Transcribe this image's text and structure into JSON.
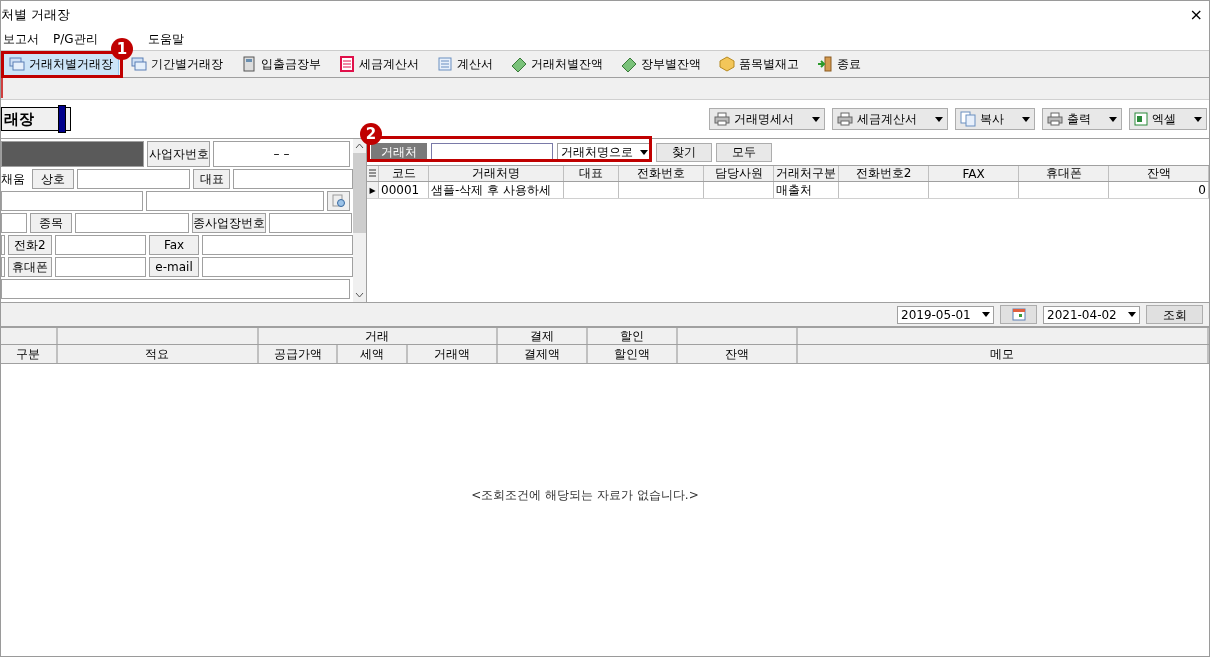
{
  "window": {
    "title": "처별 거래장",
    "close": "×"
  },
  "menu": [
    "보고서",
    "P/G관리",
    "도움말"
  ],
  "toolbar": [
    {
      "label": "거래처별거래장",
      "selected": true
    },
    {
      "label": "기간별거래장",
      "selected": false
    },
    {
      "label": "입출금장부",
      "selected": false
    },
    {
      "label": "세금계산서",
      "selected": false
    },
    {
      "label": "계산서",
      "selected": false
    },
    {
      "label": "거래처별잔액",
      "selected": false
    },
    {
      "label": "장부별잔액",
      "selected": false
    },
    {
      "label": "품목별재고",
      "selected": false
    },
    {
      "label": "종료",
      "selected": false
    }
  ],
  "page_title": "래장",
  "actions": [
    "거래명세서",
    "세금계산서",
    "복사",
    "출력",
    "엑셀"
  ],
  "form": {
    "business_no_label": "사업자번호",
    "business_no_value": "–   –",
    "fill_label": "채움",
    "name_label": "상호",
    "rep_label": "대표",
    "item_label": "종목",
    "branch_label": "종사업장번호",
    "phone2_label": "전화2",
    "fax_label": "Fax",
    "mobile_label": "휴대폰",
    "email_label": "e-mail"
  },
  "search": {
    "label": "거래처",
    "mode": "거래처명으로",
    "find": "찾기",
    "all": "모두"
  },
  "grid": {
    "columns": [
      "코드",
      "거래처명",
      "대표",
      "전화번호",
      "담당사원",
      "거래처구분",
      "전화번호2",
      "FAX",
      "휴대폰",
      "잔액"
    ],
    "rows": [
      {
        "marker": "▶",
        "cells": [
          "00001",
          "샘플-삭제 후 사용하세",
          "",
          "",
          "",
          "매출처",
          "",
          "",
          "",
          "0"
        ]
      }
    ]
  },
  "period": {
    "from": "2019-05-01",
    "to": "2021-04-02",
    "query": "조회"
  },
  "ledger": {
    "groups": [
      "거래",
      "결제",
      "할인"
    ],
    "columns": [
      "구분",
      "적요",
      "공급가액",
      "세액",
      "거래액",
      "결제액",
      "할인액",
      "잔액",
      "메모"
    ],
    "empty": "<조회조건에 해당되는 자료가 없습니다.>"
  },
  "callouts": [
    "1",
    "2"
  ]
}
